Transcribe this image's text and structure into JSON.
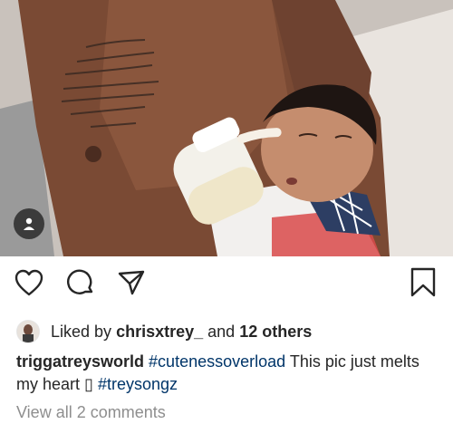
{
  "post": {
    "tag_icon": "person-icon"
  },
  "actions": {
    "like_icon": "heart-icon",
    "comment_icon": "comment-icon",
    "share_icon": "paper-plane-icon",
    "save_icon": "bookmark-icon"
  },
  "likes": {
    "prefix": "Liked by",
    "user": "chrisxtrey_",
    "connector": "and",
    "others": "12 others"
  },
  "caption": {
    "username": "triggatreysworld",
    "hashtag1": "#cutenessoverload",
    "text": "This pic just melts my heart",
    "glyph": "▯",
    "hashtag2": "#treysongz"
  },
  "comments": {
    "view_all": "View all 2 comments"
  },
  "colors": {
    "text": "#262626",
    "hashtag": "#003569",
    "muted": "#8e8e8e"
  }
}
